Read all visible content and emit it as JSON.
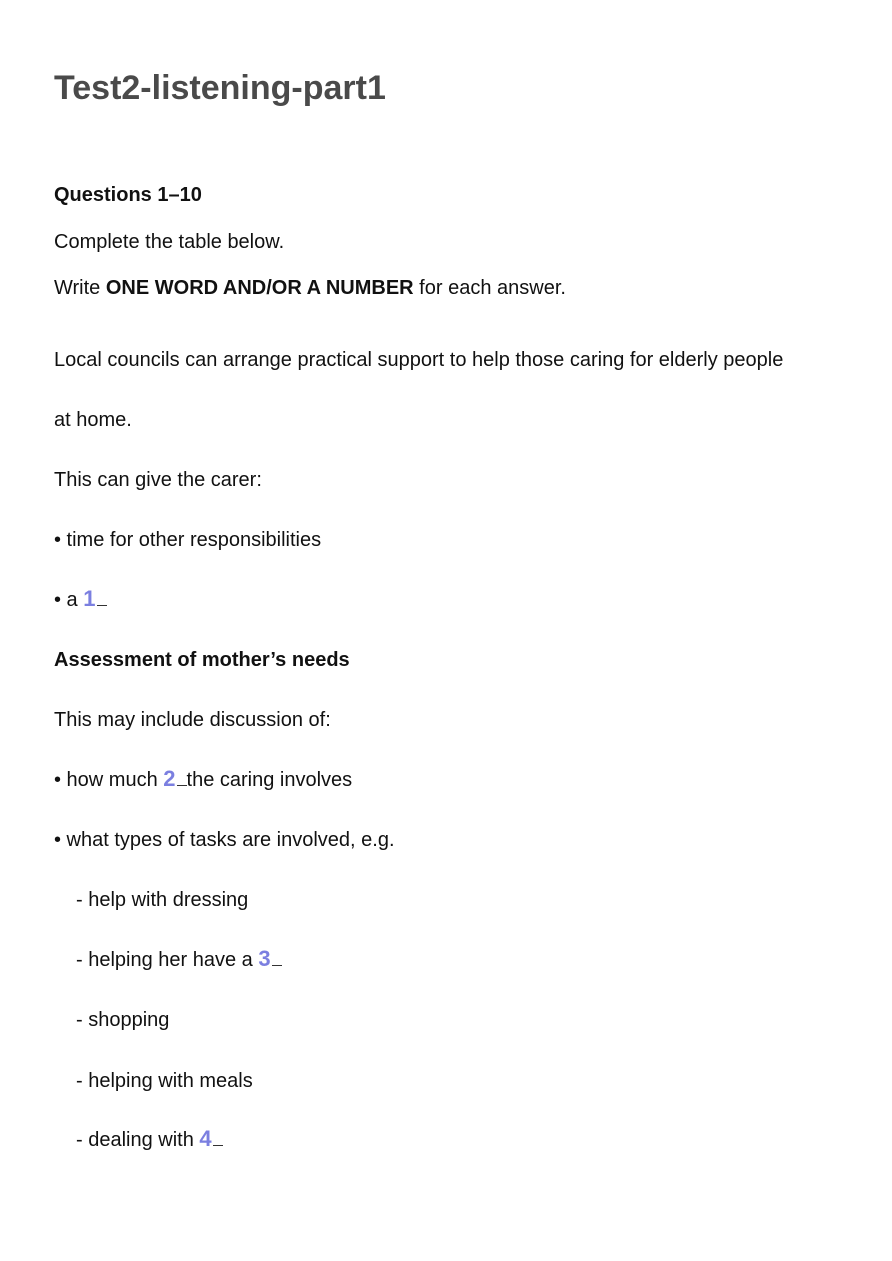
{
  "title": "Test2-listening-part1",
  "heading": "Questions 1–10",
  "instruction_1": "Complete the table below.",
  "instruction_2": {
    "prefix": "Write ",
    "emphasis": "ONE WORD AND/OR A NUMBER",
    "suffix": " for each answer."
  },
  "paragraph_1a": "Local councils can arrange practical support to help those caring for elderly people",
  "paragraph_1b": "at home.",
  "give_intro": "This can give the carer:",
  "bullet_1": "• time for other responsibilities",
  "bullet_2_prefix": "• a ",
  "q1": "1",
  "section_heading": "Assessment of mother’s needs",
  "discussion_intro": "This may include discussion of:",
  "bullet_3_prefix": "• how much ",
  "q2": "2",
  "bullet_3_suffix": "the caring involves",
  "bullet_4": "• what types of tasks are involved, e.g.",
  "sub_1": "- help with dressing",
  "sub_2_prefix": "- helping her have a ",
  "q3": "3",
  "sub_3": "- shopping",
  "sub_4": "- helping with meals",
  "sub_5_prefix": "- dealing with ",
  "q4": "4"
}
